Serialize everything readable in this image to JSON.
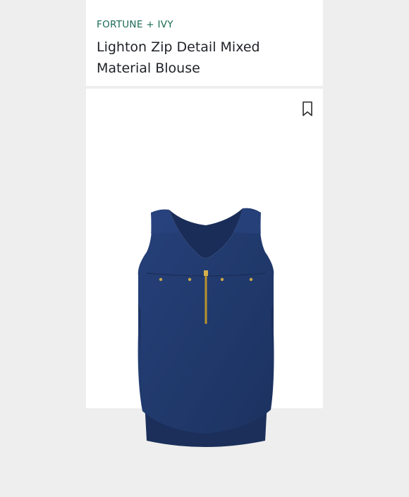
{
  "product": {
    "brand": "FORTUNE + IVY",
    "title": "Lighton Zip Detail Mixed Material Blouse",
    "image_icon": "blouse-photo",
    "bookmark_icon": "bookmark-icon"
  },
  "colors": {
    "brand_green": "#1a6a55",
    "garment_navy": "#223a6e",
    "zipper_gold": "#b8932f"
  }
}
